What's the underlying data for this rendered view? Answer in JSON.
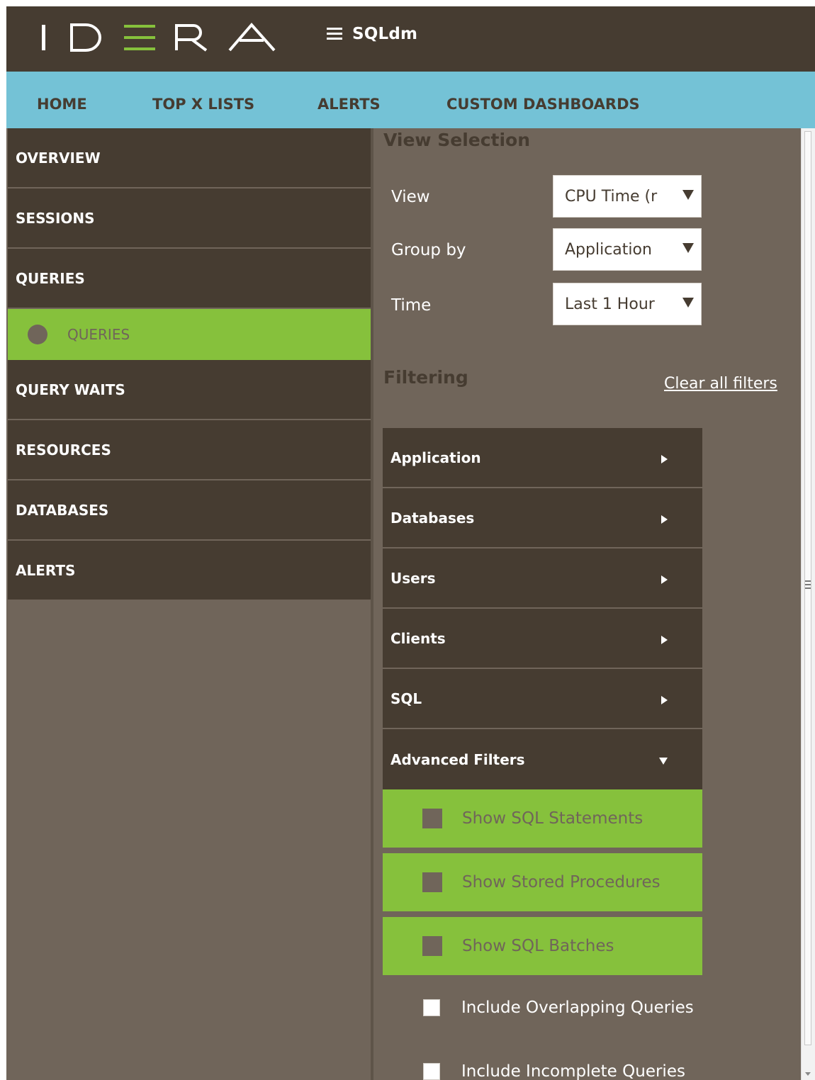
{
  "app": {
    "logo_text": "IDERA",
    "name": "SQLdm",
    "menu_icon": "hamburger-icon"
  },
  "nav": {
    "tabs": [
      {
        "label": "HOME"
      },
      {
        "label": "TOP X LISTS"
      },
      {
        "label": "ALERTS"
      },
      {
        "label": "CUSTOM DASHBOARDS"
      }
    ]
  },
  "sidebar": {
    "items": [
      {
        "label": "OVERVIEW"
      },
      {
        "label": "SESSIONS"
      },
      {
        "label": "QUERIES"
      },
      {
        "label": "QUERIES",
        "sub": true,
        "selected": true
      },
      {
        "label": "QUERY WAITS"
      },
      {
        "label": "RESOURCES"
      },
      {
        "label": "DATABASES"
      },
      {
        "label": "ALERTS"
      }
    ]
  },
  "view_selection": {
    "title": "View Selection",
    "view": {
      "label": "View",
      "value": "CPU Time (r"
    },
    "group_by": {
      "label": "Group by",
      "value": "Application"
    },
    "time": {
      "label": "Time",
      "value": "Last 1 Hour"
    }
  },
  "filtering": {
    "title": "Filtering",
    "clear_label": "Clear all filters",
    "groups": [
      {
        "label": "Application",
        "expanded": false
      },
      {
        "label": "Databases",
        "expanded": false
      },
      {
        "label": "Users",
        "expanded": false
      },
      {
        "label": "Clients",
        "expanded": false
      },
      {
        "label": "SQL",
        "expanded": false
      },
      {
        "label": "Advanced Filters",
        "expanded": true
      }
    ],
    "advanced_options": [
      {
        "label": "Show SQL Statements"
      },
      {
        "label": "Show Stored Procedures"
      },
      {
        "label": "Show SQL Batches"
      }
    ],
    "checkboxes": [
      {
        "label": "Include Overlapping Queries",
        "checked": false
      },
      {
        "label": "Include Incomplete Queries",
        "checked": false
      }
    ]
  },
  "colors": {
    "header_bg": "#463c31",
    "nav_bg": "#74c2d6",
    "panel_bg": "#70655a",
    "accent_green": "#86c13c"
  }
}
